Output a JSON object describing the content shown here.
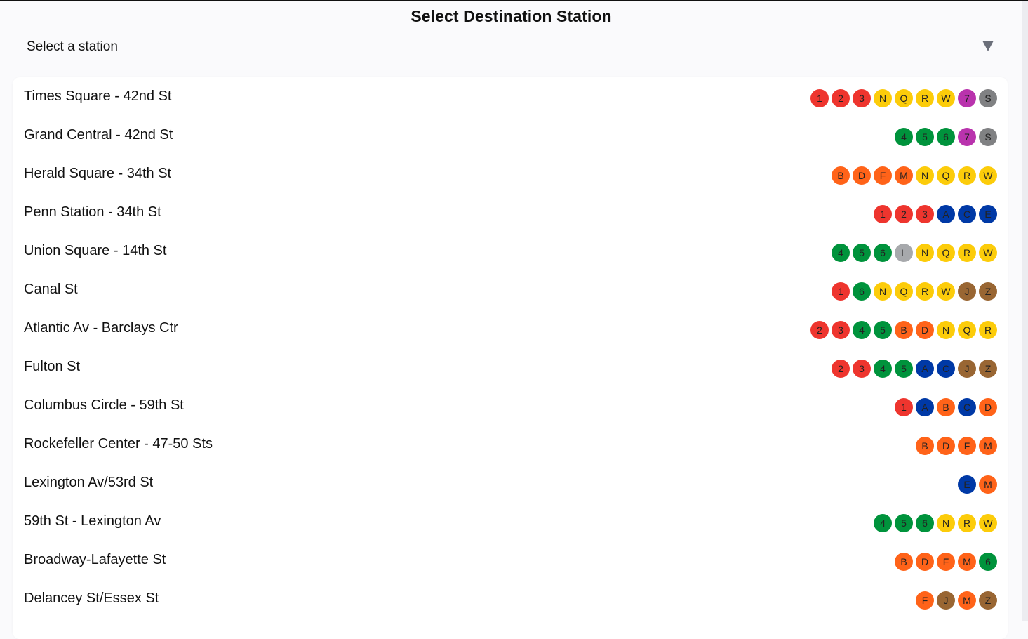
{
  "header": {
    "title": "Select Destination Station",
    "select_placeholder": "Select a station"
  },
  "line_colors": {
    "1": "#ee352e",
    "2": "#ee352e",
    "3": "#ee352e",
    "4": "#00933c",
    "5": "#00933c",
    "6": "#00933c",
    "7": "#b933ad",
    "A": "#0039a6",
    "C": "#0039a6",
    "E": "#0039a6",
    "B": "#ff6319",
    "D": "#ff6319",
    "F": "#ff6319",
    "M": "#ff6319",
    "N": "#fccc0a",
    "Q": "#fccc0a",
    "R": "#fccc0a",
    "W": "#fccc0a",
    "J": "#996633",
    "Z": "#996633",
    "L": "#a7a9ac",
    "S": "#808183"
  },
  "stations": [
    {
      "name": "Times Square - 42nd St",
      "lines": [
        "1",
        "2",
        "3",
        "N",
        "Q",
        "R",
        "W",
        "7",
        "S"
      ]
    },
    {
      "name": "Grand Central - 42nd St",
      "lines": [
        "4",
        "5",
        "6",
        "7",
        "S"
      ]
    },
    {
      "name": "Herald Square - 34th St",
      "lines": [
        "B",
        "D",
        "F",
        "M",
        "N",
        "Q",
        "R",
        "W"
      ]
    },
    {
      "name": "Penn Station - 34th St",
      "lines": [
        "1",
        "2",
        "3",
        "A",
        "C",
        "E"
      ]
    },
    {
      "name": "Union Square - 14th St",
      "lines": [
        "4",
        "5",
        "6",
        "L",
        "N",
        "Q",
        "R",
        "W"
      ]
    },
    {
      "name": "Canal St",
      "lines": [
        "1",
        "6",
        "N",
        "Q",
        "R",
        "W",
        "J",
        "Z"
      ]
    },
    {
      "name": "Atlantic Av - Barclays Ctr",
      "lines": [
        "2",
        "3",
        "4",
        "5",
        "B",
        "D",
        "N",
        "Q",
        "R"
      ]
    },
    {
      "name": "Fulton St",
      "lines": [
        "2",
        "3",
        "4",
        "5",
        "A",
        "C",
        "J",
        "Z"
      ]
    },
    {
      "name": "Columbus Circle - 59th St",
      "lines": [
        "1",
        "A",
        "B",
        "C",
        "D"
      ]
    },
    {
      "name": "Rockefeller Center - 47-50 Sts",
      "lines": [
        "B",
        "D",
        "F",
        "M"
      ]
    },
    {
      "name": "Lexington Av/53rd St",
      "lines": [
        "E",
        "M"
      ]
    },
    {
      "name": "59th St - Lexington Av",
      "lines": [
        "4",
        "5",
        "6",
        "N",
        "R",
        "W"
      ]
    },
    {
      "name": "Broadway-Lafayette St",
      "lines": [
        "B",
        "D",
        "F",
        "M",
        "6"
      ]
    },
    {
      "name": "Delancey St/Essex St",
      "lines": [
        "F",
        "J",
        "M",
        "Z"
      ]
    }
  ]
}
